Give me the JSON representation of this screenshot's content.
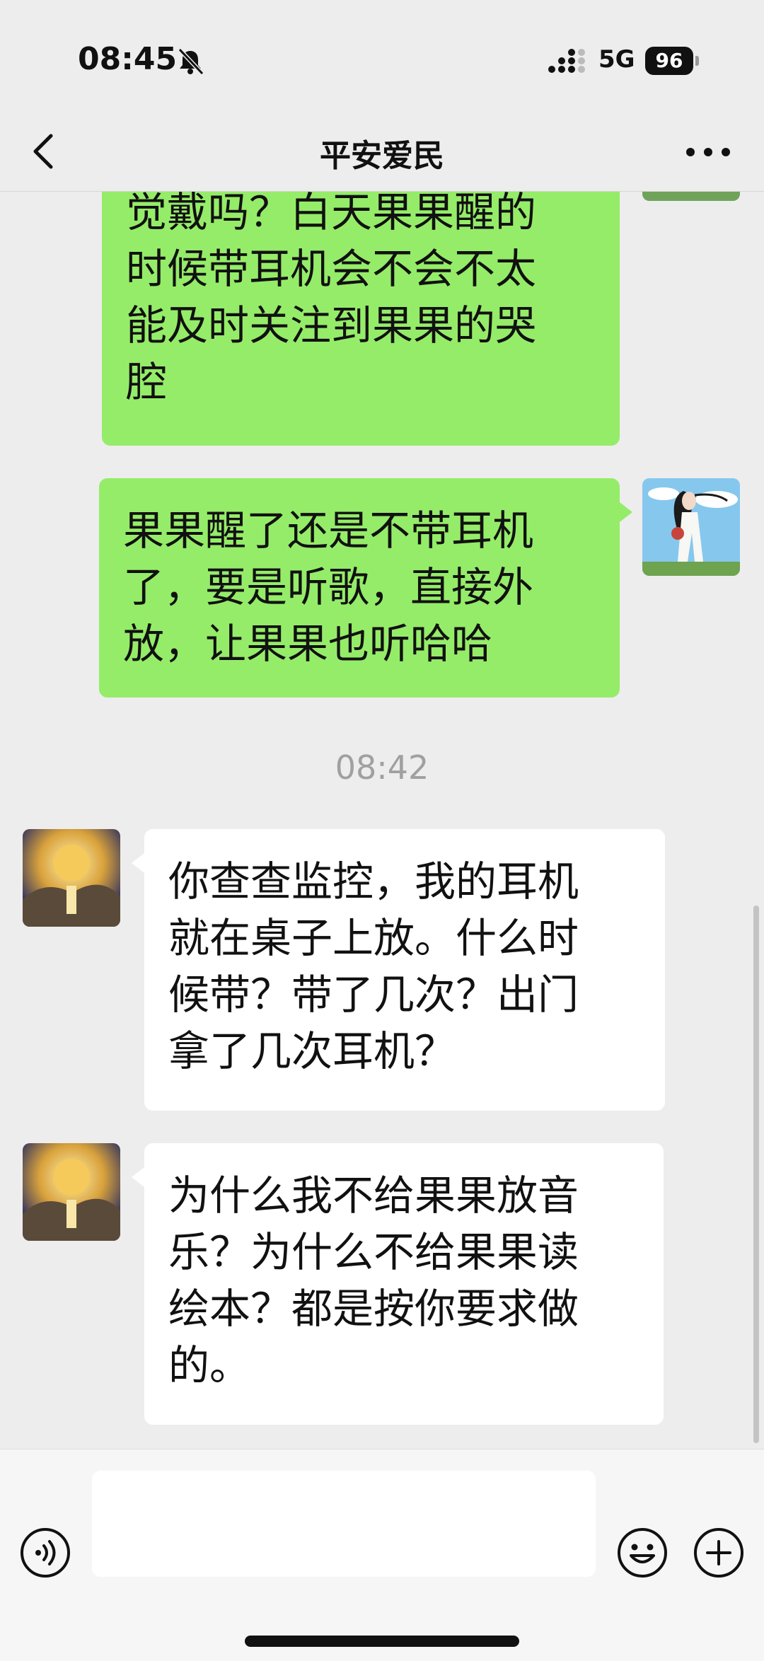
{
  "status_bar": {
    "time": "08:45",
    "network": "5G",
    "battery": "96",
    "icons": [
      "bell-muted-icon",
      "signal-icon",
      "battery-icon"
    ]
  },
  "header": {
    "title": "平安爱民",
    "icons": [
      "back-icon",
      "more-icon"
    ]
  },
  "messages": [
    {
      "side": "out",
      "text_lines": [
        "觉戴吗？白天果果醒的",
        "时候带耳机会不会不太",
        "能及时关注到果果的哭",
        "腔"
      ]
    },
    {
      "side": "out",
      "text_lines": [
        "果果醒了还是不带耳机",
        "了，要是听歌，直接外",
        "放，让果果也听哈哈"
      ]
    },
    {
      "timestamp": "08:42"
    },
    {
      "side": "in",
      "text_lines": [
        "你查查监控，我的耳机",
        "就在桌子上放。什么时",
        "候带？带了几次？出门",
        "拿了几次耳机？"
      ]
    },
    {
      "side": "in",
      "text_lines": [
        "为什么我不给果果放音",
        "乐？为什么不给果果读",
        "绘本？都是按你要求做",
        "的。"
      ]
    }
  ],
  "input_bar": {
    "value": "",
    "icons": [
      "voice-icon",
      "emoji-icon",
      "plus-icon"
    ]
  },
  "colors": {
    "outgoing_bubble": "#95ec69",
    "incoming_bubble": "#ffffff",
    "background": "#ededed"
  }
}
